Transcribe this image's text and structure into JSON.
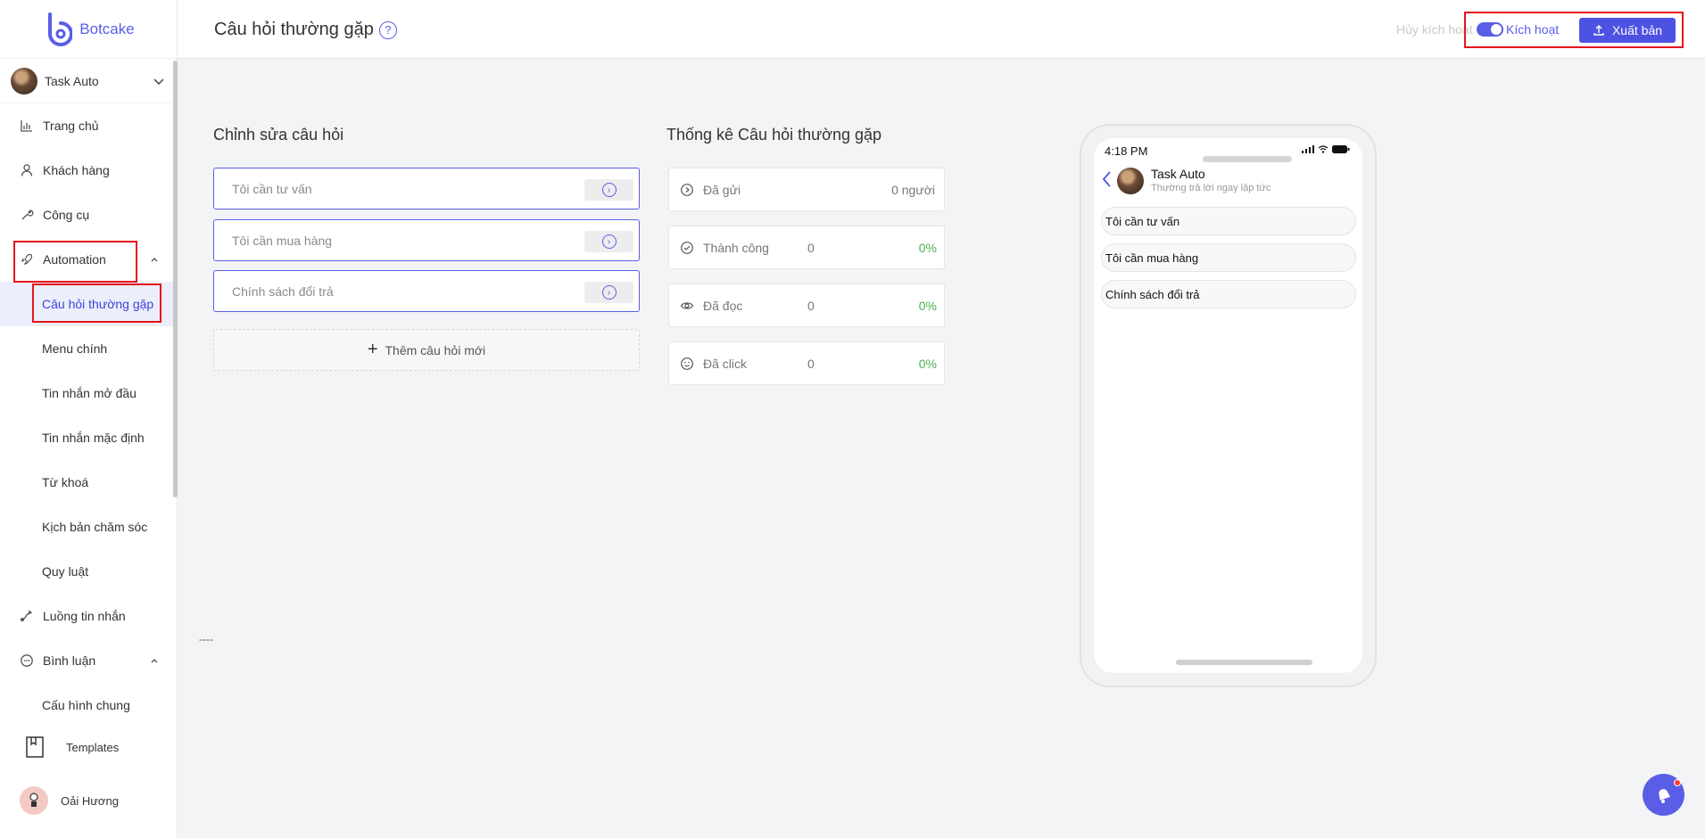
{
  "brand": {
    "name": "Botcake",
    "color": "#5a5ee6"
  },
  "page_switcher": {
    "name": "Task Auto"
  },
  "sidebar": {
    "items": [
      {
        "label": "Trang chủ",
        "icon": "chart-icon"
      },
      {
        "label": "Khách hàng",
        "icon": "user-icon"
      },
      {
        "label": "Công cụ",
        "icon": "tool-icon"
      },
      {
        "label": "Automation",
        "icon": "rocket-icon"
      }
    ],
    "automation_sub": [
      {
        "label": "Câu hỏi thường gặp",
        "active": true
      },
      {
        "label": "Menu chính"
      },
      {
        "label": "Tin nhắn mở đầu"
      },
      {
        "label": "Tin nhắn mặc định"
      },
      {
        "label": "Từ khoá"
      },
      {
        "label": "Kịch bản chăm sóc"
      },
      {
        "label": "Quy luật"
      }
    ],
    "flow": {
      "label": "Luồng tin nhắn",
      "icon": "flow-icon"
    },
    "comments": {
      "label": "Bình luận",
      "icon": "comment-icon"
    },
    "comments_sub": [
      {
        "label": "Cấu hình chung"
      }
    ],
    "templates": {
      "label": "Templates"
    },
    "user": {
      "name": "Oải Hương"
    }
  },
  "header": {
    "title": "Câu hỏi thường gặp",
    "deactivate_label": "Hủy kích hoạt",
    "activate_label": "Kích hoạt",
    "publish_label": "Xuất bản",
    "accent": "#4e52e3"
  },
  "editor": {
    "title": "Chỉnh sửa câu hỏi",
    "questions": [
      {
        "placeholder": "Tôi cần tư vấn"
      },
      {
        "placeholder": "Tôi cần mua hàng"
      },
      {
        "placeholder": "Chính sách đổi trả"
      }
    ],
    "add_label": "Thêm câu hỏi mới"
  },
  "stats": {
    "title": "Thống kê  Câu hỏi thường gặp",
    "rows": [
      {
        "label": "Đã gửi",
        "right": "0 người",
        "icon": "play-circle-icon"
      },
      {
        "label": "Thành công",
        "count": "0",
        "pct": "0%",
        "icon": "check-circle-icon"
      },
      {
        "label": "Đã đọc",
        "count": "0",
        "pct": "0%",
        "icon": "eye-icon"
      },
      {
        "label": "Đã click",
        "count": "0",
        "pct": "0%",
        "icon": "smile-icon"
      }
    ],
    "pct_color": "#4caf50"
  },
  "misc": {
    "dashes": "----"
  },
  "phone": {
    "time": "4:18 PM",
    "page_name": "Task Auto",
    "page_sub": "Thường trả lời ngay lập tức",
    "questions": [
      "Tôi cần tư vấn",
      "Tôi cần mua hàng",
      "Chính sách đổi trả"
    ]
  }
}
